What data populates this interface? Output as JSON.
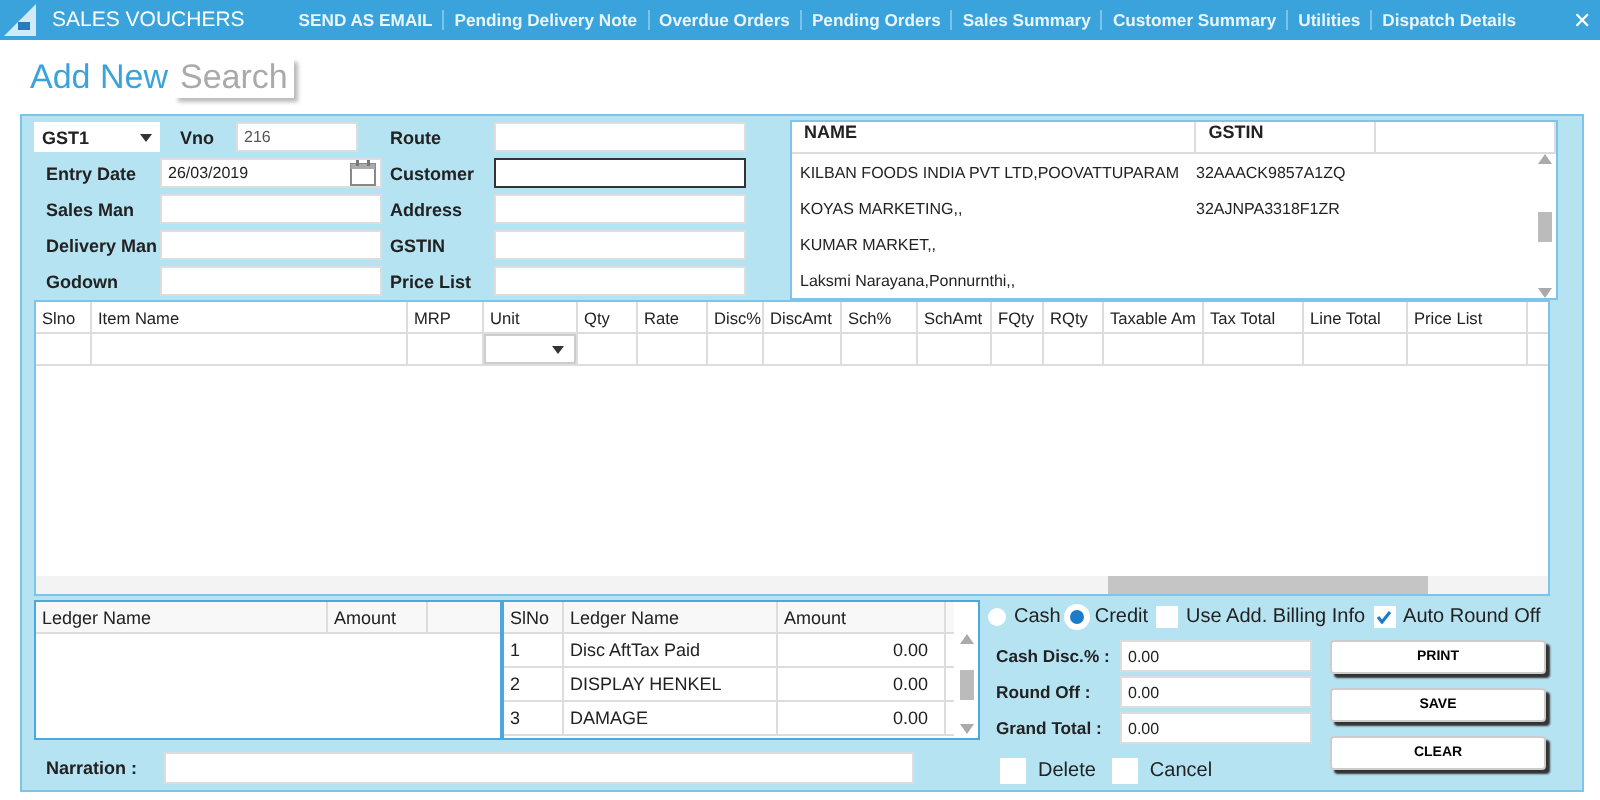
{
  "title_bar": {
    "title": "SALES VOUCHERS",
    "menu": [
      "SEND AS EMAIL",
      "Pending Delivery Note",
      "Overdue Orders",
      "Pending Orders",
      "Sales Summary",
      "Customer Summary",
      "Utilities",
      "Dispatch Details"
    ],
    "close": "✕"
  },
  "mode_tabs": [
    {
      "label": "Add New",
      "selected": true
    },
    {
      "label": "Search",
      "selected": false
    }
  ],
  "voucher_type": "GST1",
  "left_fields": [
    {
      "label": "Vno",
      "value": "216",
      "kind": "text"
    },
    {
      "label": "Entry Date",
      "value": "26/03/2019",
      "kind": "date"
    },
    {
      "label": "Sales Man",
      "kind": "text"
    },
    {
      "label": "Delivery Man",
      "kind": "text"
    },
    {
      "label": "Godown",
      "kind": "text"
    }
  ],
  "right_fields": [
    {
      "label": "Route",
      "focused": false
    },
    {
      "label": "Customer",
      "focused": true
    },
    {
      "label": "Address",
      "focused": false
    },
    {
      "label": "GSTIN",
      "focused": false
    },
    {
      "label": "Price List",
      "focused": false
    }
  ],
  "customer_list": {
    "columns": [
      "NAME",
      "GSTIN"
    ],
    "rows": [
      [
        "KILBAN FOODS INDIA PVT LTD,POOVATTUPARAM",
        "32AAACK9857A1ZQ"
      ],
      [
        "KOYAS MARKETING,,",
        "32AJNPA3318F1ZR"
      ],
      [
        "KUMAR MARKET,,",
        ""
      ],
      [
        "Laksmi Narayana,Ponnurnthi,,",
        ""
      ]
    ]
  },
  "items_table": {
    "columns": [
      "Slno",
      "Item Name",
      "MRP",
      "Unit",
      "Qty",
      "Rate",
      "Disc%",
      "DiscAmt",
      "Sch%",
      "SchAmt",
      "FQty",
      "RQty",
      "Taxable Am",
      "Tax Total",
      "Line Total",
      "Price List"
    ]
  },
  "ledger_left": {
    "columns": [
      "Ledger Name",
      "Amount"
    ]
  },
  "ledger_right": {
    "columns": [
      "SlNo",
      "Ledger Name",
      "Amount"
    ],
    "rows": [
      [
        "1",
        "Disc AftTax Paid",
        "0.00"
      ],
      [
        "2",
        "DISPLAY HENKEL",
        "0.00"
      ],
      [
        "3",
        "DAMAGE",
        "0.00"
      ]
    ]
  },
  "payment": [
    {
      "label": "Cash",
      "selected": false
    },
    {
      "label": "Credit",
      "selected": true
    }
  ],
  "options": [
    {
      "label": "Use Add. Billing Info",
      "checked": false
    },
    {
      "label": "Auto Round Off",
      "checked": true
    }
  ],
  "totals": [
    {
      "label": "Cash Disc.% :",
      "value": "0.00"
    },
    {
      "label": "Round Off :",
      "value": "0.00"
    },
    {
      "label": "Grand Total :",
      "value": "0.00"
    }
  ],
  "buttons": [
    "PRINT",
    "SAVE",
    "CLEAR"
  ],
  "bottom_checks": [
    {
      "label": "Delete",
      "checked": false
    },
    {
      "label": "Cancel",
      "checked": false
    }
  ],
  "narration": {
    "label": "Narration :"
  }
}
